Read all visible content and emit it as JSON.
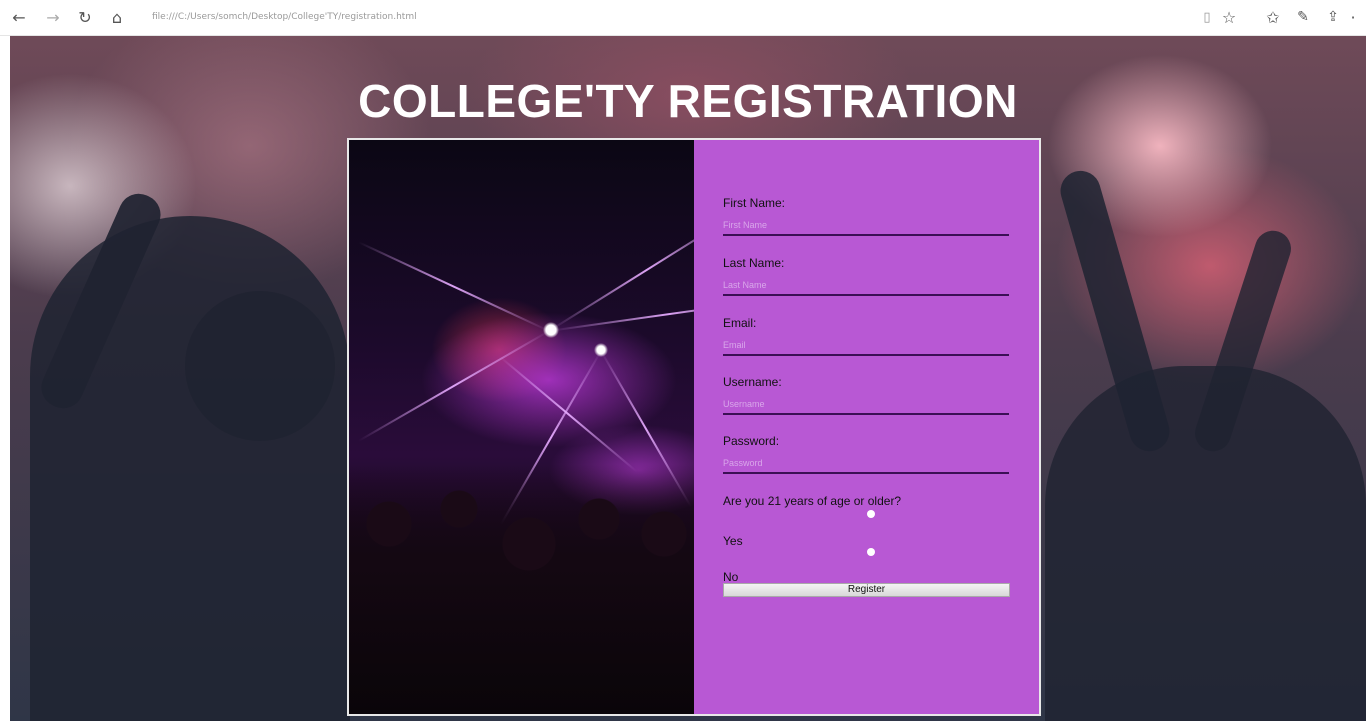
{
  "browser": {
    "url": "file:///C:/Users/somch/Desktop/College'TY/registration.html",
    "icons": [
      "back-arrow-icon",
      "forward-arrow-icon",
      "refresh-icon",
      "home-icon",
      "reading-view-icon",
      "favorite-star-icon",
      "favorites-list-icon",
      "pen-icon",
      "share-icon",
      "more-icon"
    ]
  },
  "page": {
    "title": "COLLEGE'TY REGISTRATION"
  },
  "form": {
    "first_name": {
      "label": "First Name:",
      "placeholder": "First Name"
    },
    "last_name": {
      "label": "Last Name:",
      "placeholder": "Last Name"
    },
    "email": {
      "label": "Email:",
      "placeholder": "Email"
    },
    "username": {
      "label": "Username:",
      "placeholder": "Username"
    },
    "password": {
      "label": "Password:",
      "placeholder": "Password"
    },
    "age_question": "Are you 21 years of age or older?",
    "options": [
      {
        "label": "Yes"
      },
      {
        "label": "No"
      }
    ],
    "submit_label": "Register"
  },
  "colors": {
    "form_background": "#b858d4",
    "input_underline": "#3b0f55",
    "title": "#ffffff"
  }
}
